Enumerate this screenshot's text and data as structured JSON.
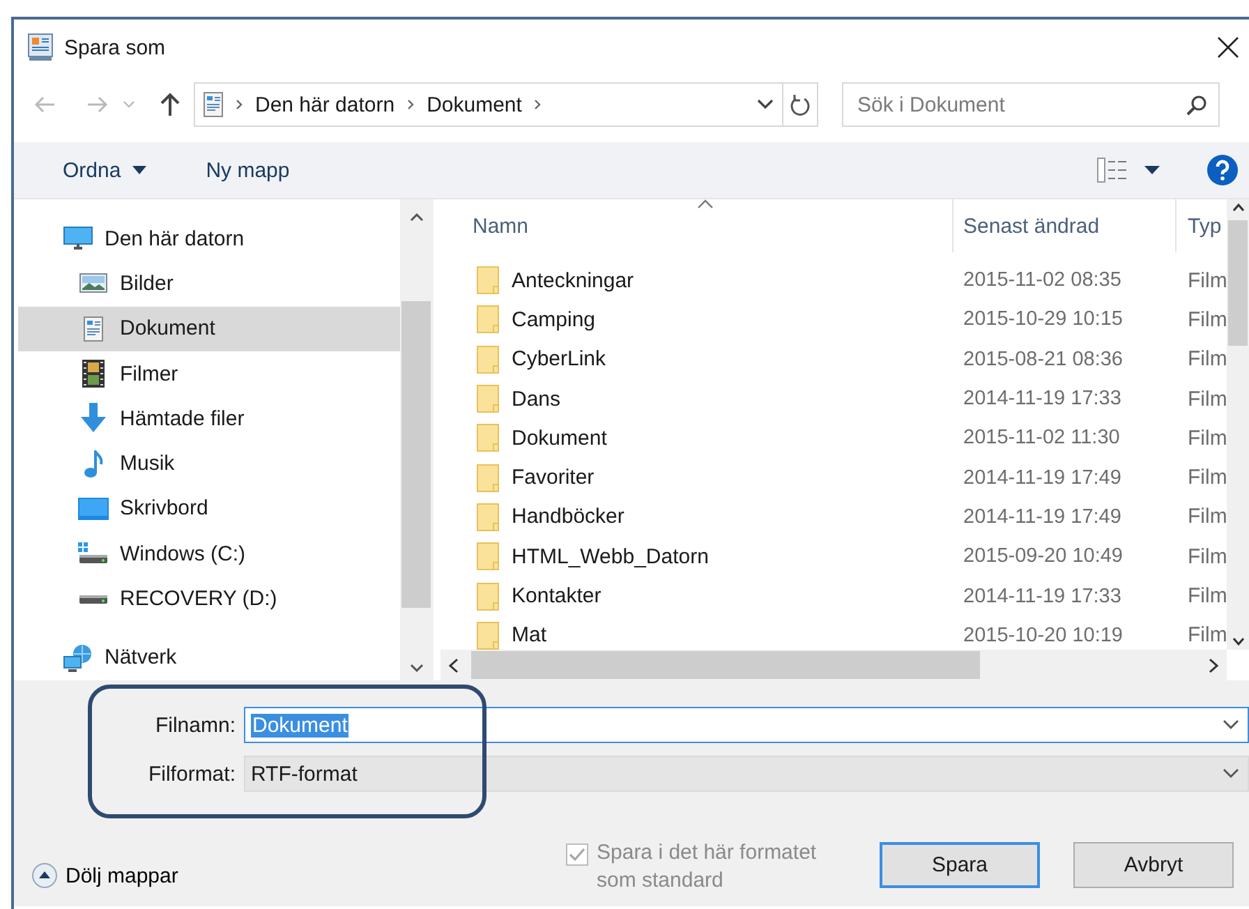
{
  "window": {
    "title": "Spara som"
  },
  "address": {
    "path": [
      "Den här datorn",
      "Dokument"
    ]
  },
  "search": {
    "placeholder": "Sök i Dokument"
  },
  "toolbar": {
    "organize": "Ordna",
    "new_folder": "Ny mapp"
  },
  "sidebar": {
    "items": [
      {
        "label": "Den här datorn",
        "selected": false,
        "children": [
          {
            "label": "Bilder",
            "selected": false
          },
          {
            "label": "Dokument",
            "selected": true
          },
          {
            "label": "Filmer",
            "selected": false
          },
          {
            "label": "Hämtade filer",
            "selected": false
          },
          {
            "label": "Musik",
            "selected": false
          },
          {
            "label": "Skrivbord",
            "selected": false
          },
          {
            "label": "Windows (C:)",
            "selected": false
          },
          {
            "label": "RECOVERY (D:)",
            "selected": false
          }
        ]
      },
      {
        "label": "Nätverk",
        "selected": false
      }
    ]
  },
  "file_list": {
    "columns": [
      "Namn",
      "Senast ändrad",
      "Typ"
    ],
    "rows": [
      {
        "name": "Anteckningar",
        "modified": "2015-11-02 08:35",
        "type": "Film"
      },
      {
        "name": "Camping",
        "modified": "2015-10-29 10:15",
        "type": "Film"
      },
      {
        "name": "CyberLink",
        "modified": "2015-08-21 08:36",
        "type": "Film"
      },
      {
        "name": "Dans",
        "modified": "2014-11-19 17:33",
        "type": "Film"
      },
      {
        "name": "Dokument",
        "modified": "2015-11-02 11:30",
        "type": "Film"
      },
      {
        "name": "Favoriter",
        "modified": "2014-11-19 17:49",
        "type": "Film"
      },
      {
        "name": "Handböcker",
        "modified": "2014-11-19 17:49",
        "type": "Film"
      },
      {
        "name": "HTML_Webb_Datorn",
        "modified": "2015-09-20 10:49",
        "type": "Film"
      },
      {
        "name": "Kontakter",
        "modified": "2014-11-19 17:33",
        "type": "Film"
      },
      {
        "name": "Mat",
        "modified": "2015-10-20 10:19",
        "type": "Film"
      }
    ]
  },
  "form": {
    "filename_label": "Filnamn:",
    "filename": "Dokument",
    "format_label": "Filformat:",
    "format": "RTF-format"
  },
  "save_default": {
    "label": "Spara i det här formatet som standard",
    "checked": true,
    "disabled": true
  },
  "hide_folders": "Dölj mappar",
  "buttons": [
    {
      "label": "Spara",
      "default": true
    },
    {
      "label": "Avbryt",
      "default": false
    }
  ]
}
